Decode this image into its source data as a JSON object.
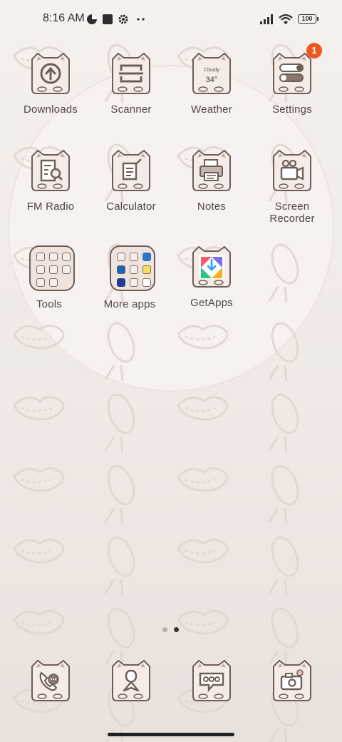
{
  "status_bar": {
    "time": "8:16 AM",
    "battery": "100",
    "left_icons": [
      "data-saver-icon",
      "screen-record-icon",
      "gear-icon",
      "more-dots-icon"
    ],
    "right_icons": [
      "signal-icon",
      "wifi-icon",
      "battery-icon"
    ]
  },
  "apps": [
    {
      "label": "Downloads",
      "icon": "download-arrow-icon"
    },
    {
      "label": "Scanner",
      "icon": "scanner-icon"
    },
    {
      "label": "Weather",
      "icon": "weather-icon",
      "widget_text": "Cloudy",
      "widget_temp": "34°"
    },
    {
      "label": "Settings",
      "icon": "toggles-icon",
      "badge": "1"
    },
    {
      "label": "FM Radio",
      "icon": "radio-doc-search-icon"
    },
    {
      "label": "Calculator",
      "icon": "calculator-icon"
    },
    {
      "label": "Notes",
      "icon": "printer-icon"
    },
    {
      "label": "Screen Recorder",
      "label_line1": "Screen",
      "label_line2": "Recorder",
      "icon": "video-camera-icon"
    }
  ],
  "folders": [
    {
      "label": "Tools",
      "icon": "folder-icon"
    },
    {
      "label": "More apps",
      "icon": "folder-icon"
    }
  ],
  "getapps": {
    "label": "GetApps",
    "icon": "getapps-icon"
  },
  "page_indicator": {
    "count": 2,
    "active": 2
  },
  "dock": [
    {
      "name": "phone",
      "icon": "phone-icon"
    },
    {
      "name": "contacts",
      "icon": "contacts-icon"
    },
    {
      "name": "messages",
      "icon": "chat-bubble-icon"
    },
    {
      "name": "camera",
      "icon": "camera-icon"
    }
  ],
  "colors": {
    "accent_badge": "#f0581e",
    "icon_outline": "#6e5e58",
    "icon_fill": "#f6ece7",
    "background": "#f2ece8"
  }
}
